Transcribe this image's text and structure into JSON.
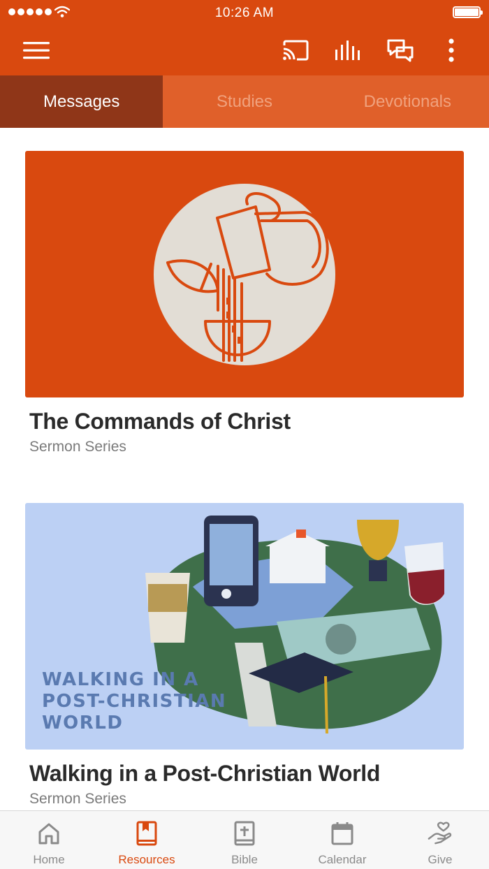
{
  "status_bar": {
    "time": "10:26 AM"
  },
  "app_bar": {
    "icons": [
      "menu-icon",
      "cast-icon",
      "audio-bars-icon",
      "chat-icon",
      "more-vertical-icon"
    ]
  },
  "tabs": [
    {
      "label": "Messages",
      "active": true
    },
    {
      "label": "Studies",
      "active": false
    },
    {
      "label": "Devotionals",
      "active": false
    }
  ],
  "cards": [
    {
      "title": "The Commands of Christ",
      "subtitle": "Sermon Series",
      "art_color": "#d9490f"
    },
    {
      "title": "Walking in a Post-Christian World",
      "subtitle": "Sermon Series",
      "art_text_lines": [
        "WALKING IN A",
        "POST-CHRISTIAN",
        "WORLD"
      ],
      "art_color": "#bcd0f4"
    }
  ],
  "bottom_nav": [
    {
      "label": "Home",
      "icon": "home-icon",
      "active": false
    },
    {
      "label": "Resources",
      "icon": "bookmark-book-icon",
      "active": true
    },
    {
      "label": "Bible",
      "icon": "bible-icon",
      "active": false
    },
    {
      "label": "Calendar",
      "icon": "calendar-icon",
      "active": false
    },
    {
      "label": "Give",
      "icon": "give-heart-icon",
      "active": false
    }
  ],
  "colors": {
    "brand": "#d9490f",
    "active_tab": "#8f3618",
    "inactive_tab_text": "#f0a27e",
    "nav_inactive": "#8a8a8a"
  }
}
